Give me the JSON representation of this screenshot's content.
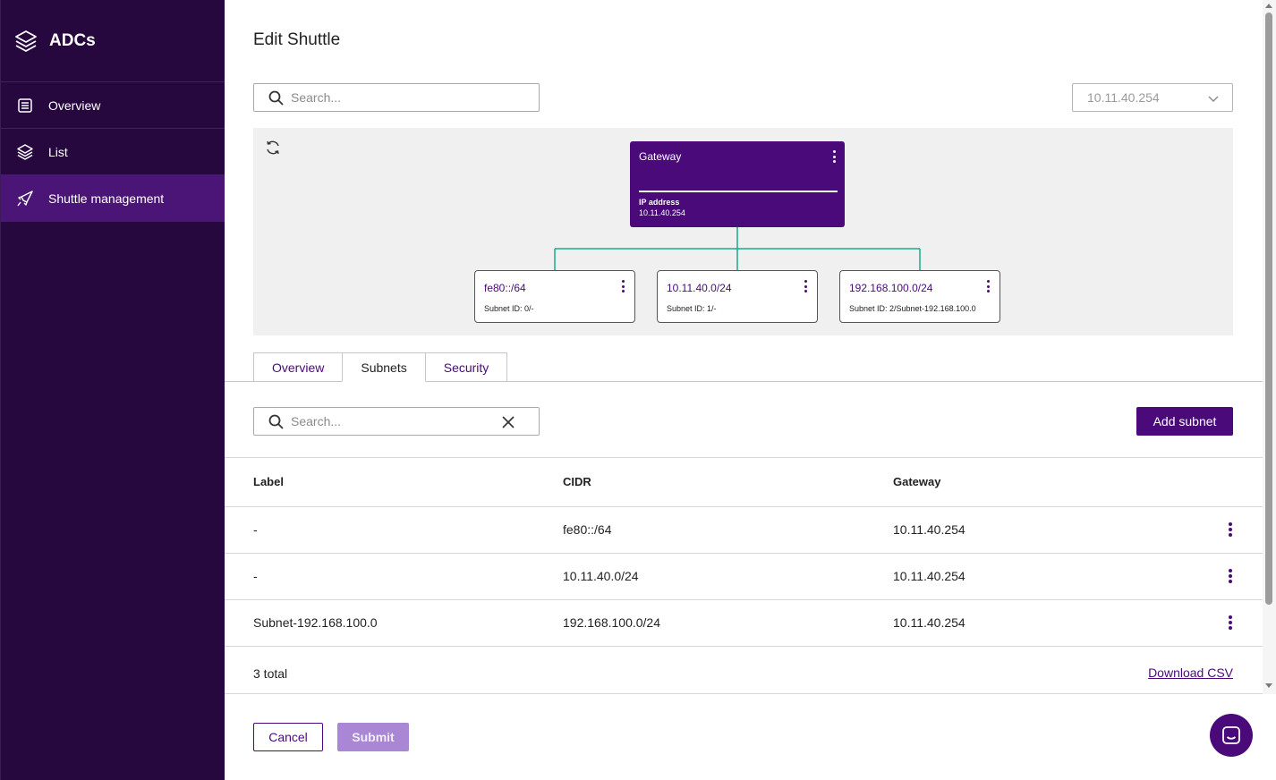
{
  "app": {
    "title": "ADCs"
  },
  "sidebar": {
    "items": [
      {
        "label": "Overview",
        "icon": "overview-icon",
        "active": false
      },
      {
        "label": "List",
        "icon": "layers-icon",
        "active": false
      },
      {
        "label": "Shuttle management",
        "icon": "rocket-icon",
        "active": true
      }
    ]
  },
  "page": {
    "title": "Edit Shuttle"
  },
  "top_search": {
    "placeholder": "Search...",
    "value": ""
  },
  "gateway_select": {
    "value": "10.11.40.254"
  },
  "topology": {
    "gateway": {
      "title": "Gateway",
      "ip_label": "IP address",
      "ip": "10.11.40.254"
    },
    "subnets": [
      {
        "cidr": "fe80::/64",
        "subnet_id": "Subnet ID: 0/-"
      },
      {
        "cidr": "10.11.40.0/24",
        "subnet_id": "Subnet ID: 1/-"
      },
      {
        "cidr": "192.168.100.0/24",
        "subnet_id": "Subnet ID: 2/Subnet-192.168.100.0"
      }
    ],
    "link_color": "#1aaa8a"
  },
  "tabs": [
    {
      "label": "Overview",
      "active": false
    },
    {
      "label": "Subnets",
      "active": true
    },
    {
      "label": "Security",
      "active": false
    }
  ],
  "subnet_search": {
    "placeholder": "Search...",
    "value": ""
  },
  "add_button": {
    "label": "Add subnet"
  },
  "table": {
    "columns": [
      "Label",
      "CIDR",
      "Gateway"
    ],
    "rows": [
      {
        "label": "-",
        "cidr": "fe80::/64",
        "gateway": "10.11.40.254"
      },
      {
        "label": "-",
        "cidr": "10.11.40.0/24",
        "gateway": "10.11.40.254"
      },
      {
        "label": "Subnet-192.168.100.0",
        "cidr": "192.168.100.0/24",
        "gateway": "10.11.40.254"
      }
    ],
    "total": "3 total",
    "download": "Download CSV"
  },
  "footer": {
    "cancel": "Cancel",
    "submit": "Submit"
  },
  "colors": {
    "brand": "#4a0a7a",
    "sidebar_bg": "#26083f",
    "submit_disabled": "#a987d4"
  }
}
